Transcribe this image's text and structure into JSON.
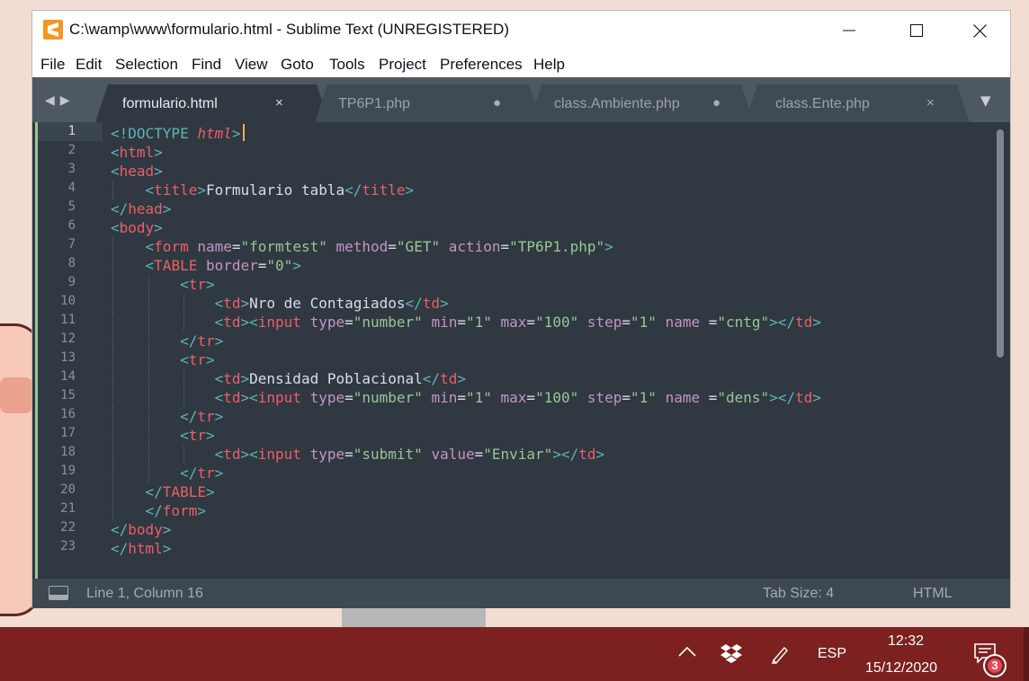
{
  "window": {
    "title": "C:\\wamp\\www\\formulario.html - Sublime Text (UNREGISTERED)",
    "controls": [
      "minimize-icon",
      "maximize-icon",
      "close-icon"
    ]
  },
  "menu": [
    "File",
    "Edit",
    "Selection",
    "Find",
    "View",
    "Goto",
    "Tools",
    "Project",
    "Preferences",
    "Help"
  ],
  "tabs": [
    {
      "label": "formulario.html",
      "indicator": "×",
      "active": true
    },
    {
      "label": "TP6P1.php",
      "indicator": "●",
      "active": false
    },
    {
      "label": "class.Ambiente.php",
      "indicator": "●",
      "active": false
    },
    {
      "label": "class.Ente.php",
      "indicator": "×",
      "active": false
    }
  ],
  "editor": {
    "lines": [
      [
        [
          "t",
          "<!DOCTYPE "
        ],
        [
          "it",
          "html"
        ],
        [
          "t",
          ">"
        ]
      ],
      [
        [
          "t",
          "<"
        ],
        [
          "n",
          "html"
        ],
        [
          "t",
          ">"
        ]
      ],
      [
        [
          "t",
          "<"
        ],
        [
          "n",
          "head"
        ],
        [
          "t",
          ">"
        ]
      ],
      [
        [
          "p",
          "    "
        ],
        [
          "t",
          "<"
        ],
        [
          "n",
          "title"
        ],
        [
          "t",
          ">"
        ],
        [
          "p",
          "Formulario tabla"
        ],
        [
          "t",
          "</"
        ],
        [
          "n",
          "title"
        ],
        [
          "t",
          ">"
        ]
      ],
      [
        [
          "t",
          "</"
        ],
        [
          "n",
          "head"
        ],
        [
          "t",
          ">"
        ]
      ],
      [
        [
          "t",
          "<"
        ],
        [
          "n",
          "body"
        ],
        [
          "t",
          ">"
        ]
      ],
      [
        [
          "p",
          "    "
        ],
        [
          "t",
          "<"
        ],
        [
          "n",
          "form "
        ],
        [
          "a",
          "name"
        ],
        [
          "p",
          "="
        ],
        [
          "s",
          "\"formtest\" "
        ],
        [
          "a",
          "method"
        ],
        [
          "p",
          "="
        ],
        [
          "s",
          "\"GET\" "
        ],
        [
          "a",
          "action"
        ],
        [
          "p",
          "="
        ],
        [
          "s",
          "\"TP6P1.php\""
        ],
        [
          "t",
          ">"
        ]
      ],
      [
        [
          "p",
          "    "
        ],
        [
          "t",
          "<"
        ],
        [
          "n",
          "TABLE "
        ],
        [
          "a",
          "border"
        ],
        [
          "p",
          "="
        ],
        [
          "s",
          "\"0\""
        ],
        [
          "t",
          ">"
        ]
      ],
      [
        [
          "p",
          "        "
        ],
        [
          "t",
          "<"
        ],
        [
          "n",
          "tr"
        ],
        [
          "t",
          ">"
        ]
      ],
      [
        [
          "p",
          "            "
        ],
        [
          "t",
          "<"
        ],
        [
          "n",
          "td"
        ],
        [
          "t",
          ">"
        ],
        [
          "p",
          "Nro de Contagiados"
        ],
        [
          "t",
          "</"
        ],
        [
          "n",
          "td"
        ],
        [
          "t",
          ">"
        ]
      ],
      [
        [
          "p",
          "            "
        ],
        [
          "t",
          "<"
        ],
        [
          "n",
          "td"
        ],
        [
          "t",
          "><"
        ],
        [
          "n",
          "input "
        ],
        [
          "a",
          "type"
        ],
        [
          "p",
          "="
        ],
        [
          "s",
          "\"number\" "
        ],
        [
          "a",
          "min"
        ],
        [
          "p",
          "="
        ],
        [
          "s",
          "\"1\" "
        ],
        [
          "a",
          "max"
        ],
        [
          "p",
          "="
        ],
        [
          "s",
          "\"100\" "
        ],
        [
          "a",
          "step"
        ],
        [
          "p",
          "="
        ],
        [
          "s",
          "\"1\" "
        ],
        [
          "a",
          "name "
        ],
        [
          "p",
          "="
        ],
        [
          "s",
          "\"cntg\""
        ],
        [
          "t",
          "></"
        ],
        [
          "n",
          "td"
        ],
        [
          "t",
          ">"
        ]
      ],
      [
        [
          "p",
          "        "
        ],
        [
          "t",
          "</"
        ],
        [
          "n",
          "tr"
        ],
        [
          "t",
          ">"
        ]
      ],
      [
        [
          "p",
          "        "
        ],
        [
          "t",
          "<"
        ],
        [
          "n",
          "tr"
        ],
        [
          "t",
          ">"
        ]
      ],
      [
        [
          "p",
          "            "
        ],
        [
          "t",
          "<"
        ],
        [
          "n",
          "td"
        ],
        [
          "t",
          ">"
        ],
        [
          "p",
          "Densidad Poblacional"
        ],
        [
          "t",
          "</"
        ],
        [
          "n",
          "td"
        ],
        [
          "t",
          ">"
        ]
      ],
      [
        [
          "p",
          "            "
        ],
        [
          "t",
          "<"
        ],
        [
          "n",
          "td"
        ],
        [
          "t",
          "><"
        ],
        [
          "n",
          "input "
        ],
        [
          "a",
          "type"
        ],
        [
          "p",
          "="
        ],
        [
          "s",
          "\"number\" "
        ],
        [
          "a",
          "min"
        ],
        [
          "p",
          "="
        ],
        [
          "s",
          "\"1\" "
        ],
        [
          "a",
          "max"
        ],
        [
          "p",
          "="
        ],
        [
          "s",
          "\"100\" "
        ],
        [
          "a",
          "step"
        ],
        [
          "p",
          "="
        ],
        [
          "s",
          "\"1\" "
        ],
        [
          "a",
          "name "
        ],
        [
          "p",
          "="
        ],
        [
          "s",
          "\"dens\""
        ],
        [
          "t",
          "></"
        ],
        [
          "n",
          "td"
        ],
        [
          "t",
          ">"
        ]
      ],
      [
        [
          "p",
          "        "
        ],
        [
          "t",
          "</"
        ],
        [
          "n",
          "tr"
        ],
        [
          "t",
          ">"
        ]
      ],
      [
        [
          "p",
          "        "
        ],
        [
          "t",
          "<"
        ],
        [
          "n",
          "tr"
        ],
        [
          "t",
          ">"
        ]
      ],
      [
        [
          "p",
          "            "
        ],
        [
          "t",
          "<"
        ],
        [
          "n",
          "td"
        ],
        [
          "t",
          "><"
        ],
        [
          "n",
          "input "
        ],
        [
          "a",
          "type"
        ],
        [
          "p",
          "="
        ],
        [
          "s",
          "\"submit\" "
        ],
        [
          "a",
          "value"
        ],
        [
          "p",
          "="
        ],
        [
          "s",
          "\"Enviar\""
        ],
        [
          "t",
          "></"
        ],
        [
          "n",
          "td"
        ],
        [
          "t",
          ">"
        ]
      ],
      [
        [
          "p",
          "        "
        ],
        [
          "t",
          "</"
        ],
        [
          "n",
          "tr"
        ],
        [
          "t",
          ">"
        ]
      ],
      [
        [
          "p",
          "    "
        ],
        [
          "t",
          "</"
        ],
        [
          "n",
          "TABLE"
        ],
        [
          "t",
          ">"
        ]
      ],
      [
        [
          "p",
          "    "
        ],
        [
          "t",
          "</"
        ],
        [
          "n",
          "form"
        ],
        [
          "t",
          ">"
        ]
      ],
      [
        [
          "t",
          "</"
        ],
        [
          "n",
          "body"
        ],
        [
          "t",
          ">"
        ]
      ],
      [
        [
          "t",
          "</"
        ],
        [
          "n",
          "html"
        ],
        [
          "t",
          ">"
        ]
      ]
    ],
    "current_line": 1
  },
  "status": {
    "position": "Line 1, Column 16",
    "tab_size": "Tab Size: 4",
    "syntax": "HTML"
  },
  "taskbar": {
    "language": "ESP",
    "time": "12:32",
    "date": "15/12/2020",
    "notification_count": "3"
  },
  "colors": {
    "editor_bg": "#303841",
    "tag_bracket": "#5fb4b4",
    "tag_name": "#ec5f67",
    "attribute": "#c594c5",
    "string": "#99c794",
    "cursor": "#f9ae58",
    "taskbar": "#7c2120"
  }
}
